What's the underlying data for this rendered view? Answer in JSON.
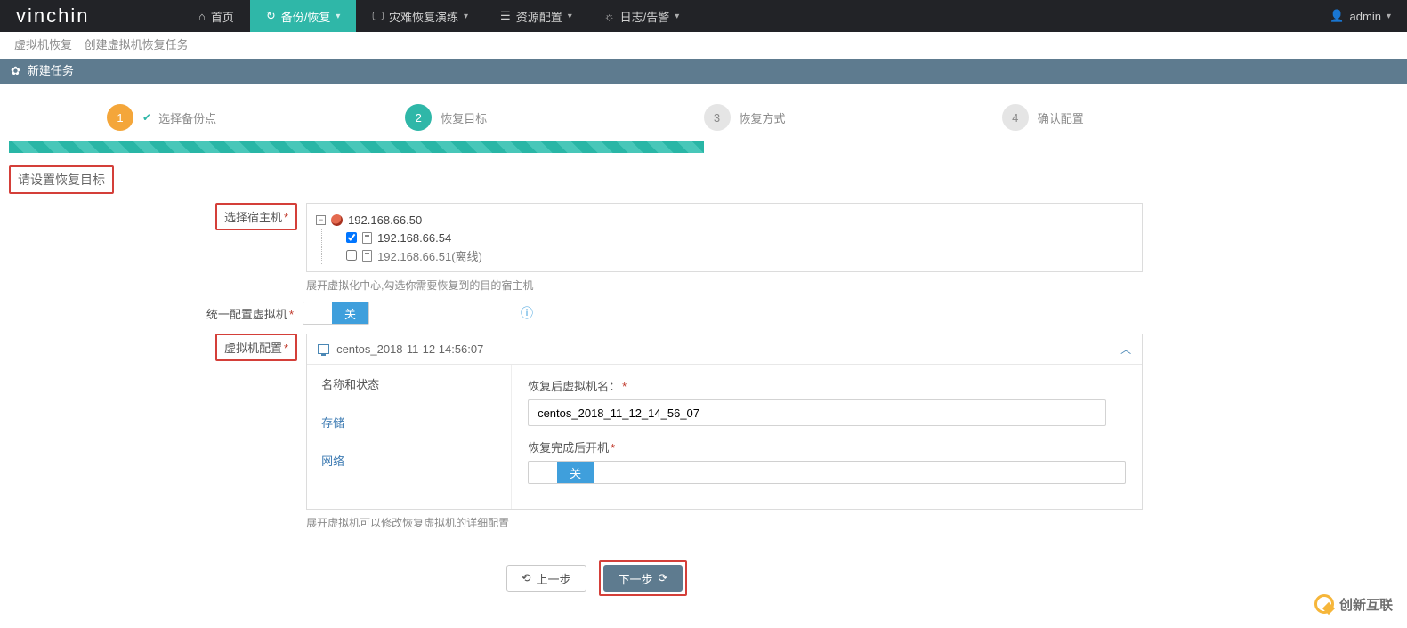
{
  "brand": "vinchin",
  "nav": {
    "home": "首页",
    "backup": "备份/恢复",
    "dr": "灾难恢复演练",
    "resource": "资源配置",
    "log": "日志/告警"
  },
  "user": {
    "name": "admin"
  },
  "crumbs": {
    "a": "虚拟机恢复",
    "b": "创建虚拟机恢复任务"
  },
  "panel_title": "新建任务",
  "steps": {
    "s1": {
      "num": "1",
      "label": "选择备份点"
    },
    "s2": {
      "num": "2",
      "label": "恢复目标"
    },
    "s3": {
      "num": "3",
      "label": "恢复方式"
    },
    "s4": {
      "num": "4",
      "label": "确认配置"
    }
  },
  "section_target": "请设置恢复目标",
  "form": {
    "host_label": "选择宿主机",
    "host_hint": "展开虚拟化中心,勾选你需要恢复到的目的宿主机",
    "unified_label": "统一配置虚拟机",
    "toggle_off": "关",
    "vmcfg_label": "虚拟机配置",
    "vmcfg_hint": "展开虚拟机可以修改恢复虚拟机的详细配置"
  },
  "tree": {
    "root": "192.168.66.50",
    "h1": "192.168.66.54",
    "h2": "192.168.66.51(离线)"
  },
  "acc": {
    "title": "centos_2018-11-12 14:56:07",
    "nav": {
      "name_state": "名称和状态",
      "storage": "存储",
      "network": "网络"
    },
    "fields": {
      "vmname_label": "恢复后虚拟机名：",
      "vmname_value": "centos_2018_11_12_14_56_07",
      "poweron_label": "恢复完成后开机",
      "poweron_off": "关"
    }
  },
  "buttons": {
    "prev": "上一步",
    "next": "下一步"
  },
  "watermark": "创新互联"
}
